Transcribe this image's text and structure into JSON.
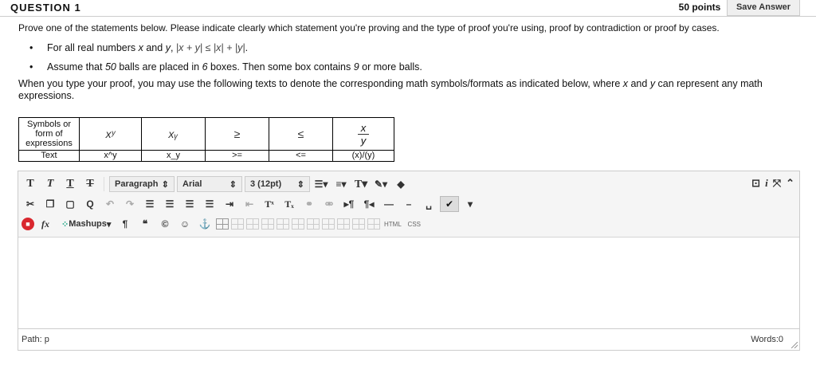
{
  "question": {
    "title": "QUESTION 1",
    "points": "50 points",
    "save_label": "Save Answer",
    "prompt": "Prove one of the statements below. Please indicate clearly which statement you're proving and the type of proof you're using, proof by contradiction or proof by cases.",
    "statements": [
      {
        "pre": "For all real numbers ",
        "v1": "x",
        "mid": " and ",
        "v2": "y",
        "post": ", ",
        "math": "|x + y| ≤ |x| + |y|",
        "end": "."
      },
      {
        "pre": "Assume that ",
        "n1": "50",
        "mid1": " balls are placed in ",
        "n2": "6",
        "mid2": " boxes. Then some box contains ",
        "n3": "9",
        "end": " or more balls."
      }
    ],
    "help_pre": "When you type your proof, you may use the following texts to denote the corresponding math symbols/formats as indicated below, where ",
    "help_x": "x",
    "help_and": " and ",
    "help_y": "y",
    "help_post": " can represent any math expressions."
  },
  "symbol_table": {
    "header_label": "Symbols or form of expressions",
    "text_label": "Text",
    "symbols": [
      "xʸ",
      "xᵧ",
      "≥",
      "≤"
    ],
    "frac_num": "x",
    "frac_den": "y",
    "texts": [
      "x^y",
      "x_y",
      ">=",
      "<=",
      "(x)/(y)"
    ]
  },
  "toolbar": {
    "paragraph": "Paragraph",
    "font": "Arial",
    "size": "3 (12pt)",
    "mashups": "Mashups",
    "html": "HTML",
    "css": "CSS"
  },
  "status": {
    "path": "Path: p",
    "words": "Words:0"
  }
}
